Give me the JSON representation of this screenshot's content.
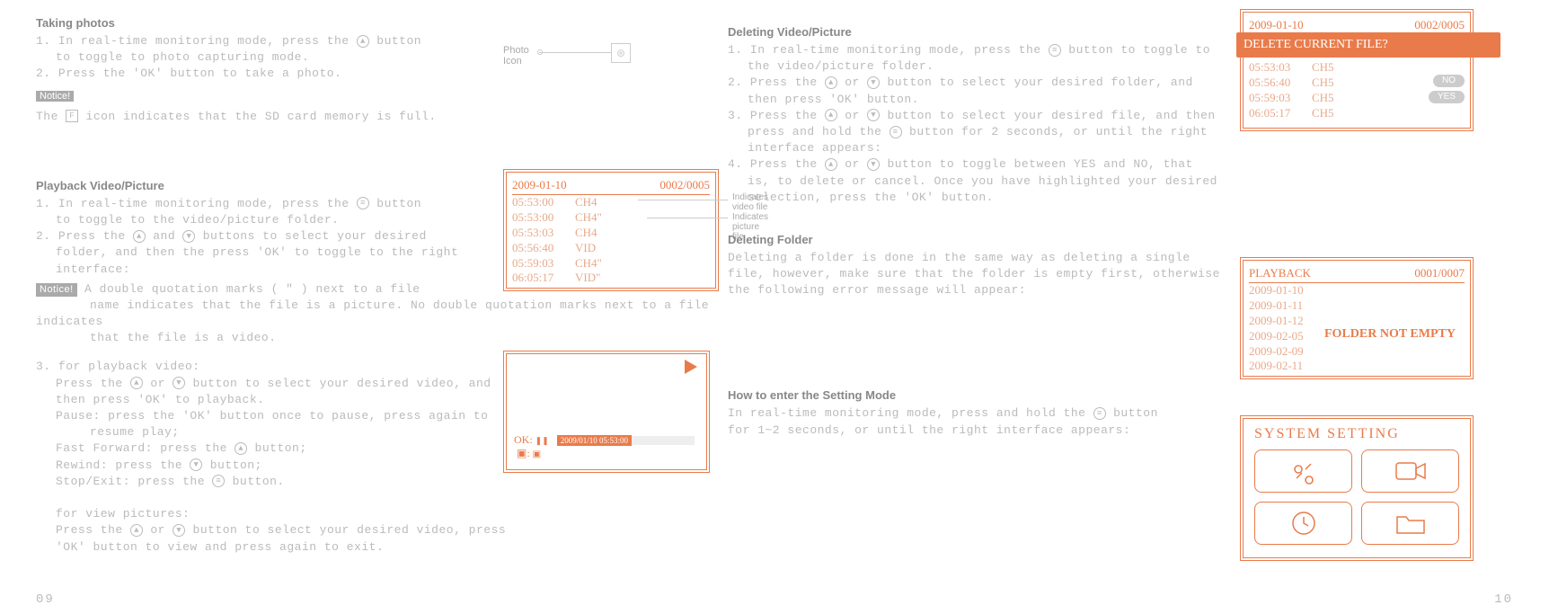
{
  "left": {
    "taking_photos": {
      "title": "Taking photos",
      "steps": [
        "1. In real-time monitoring mode, press the ▲ button to toggle to photo capturing mode.",
        "2. Press the 'OK' button to take a photo."
      ],
      "notice_label": "Notice!",
      "notice_text": "The",
      "notice_text2": "icon indicates that the SD card memory is full.",
      "f_icon": "F",
      "photo_icon_label": "Photo\nIcon",
      "camera_glyph": "⊛"
    },
    "playback": {
      "title": "Playback Video/Picture",
      "step1": "1. In real-time monitoring mode, press the ≡ button to toggle to the video/picture folder.",
      "step2": "2. Press the ▲ and ▼ buttons to select your desired folder, and then the press 'OK' to toggle to the right interface:",
      "notice_label": "Notice!",
      "notice_text": "A double quotation marks ( \" ) next to a file name indicates that the file is a picture. No double quotation marks next to a file indicates that the file is a video.",
      "step3_lead": "3. for playback video:",
      "step3_a": "Press the ▲ or ▼ button to select your desired video, and then press 'OK' to playback.",
      "step3_pause": "Pause: press the 'OK' button once to pause, press again to resume play;",
      "step3_ff": "Fast Forward: press the ▲ button;",
      "step3_rw": "Rewind: press the ▼ button;",
      "step3_stop": "Stop/Exit: press the ≡ button.",
      "step3_pics_lead": "for view pictures:",
      "step3_pics": "Press the ▲ or ▼ button to select your desired video, press 'OK' button to view and press again to exit."
    },
    "playback_screen": {
      "date": "2009-01-10",
      "counter": "0002/0005",
      "rows": [
        {
          "time": "05:53:00",
          "ch": "CH4"
        },
        {
          "time": "05:53:00",
          "ch": "CH4\""
        },
        {
          "time": "05:53:03",
          "ch": "CH4"
        },
        {
          "time": "05:56:40",
          "ch": "VID"
        },
        {
          "time": "05:59:03",
          "ch": "CH4\""
        },
        {
          "time": "06:05:17",
          "ch": "VID\""
        }
      ]
    },
    "callouts": {
      "video": "Indicates\nvideo file",
      "picture": "Indicates\npicture file"
    },
    "player": {
      "ok_label": "OK:",
      "pause_glyph": "❚❚",
      "timestamp": "2009/01/10   05:53:00",
      "exit_glyph": "▣:",
      "exit_icon": "▣"
    },
    "page_number": "09"
  },
  "right": {
    "deleting_file": {
      "title": "Deleting Video/Picture",
      "step1": "1. In real-time monitoring mode, press the ≡ button to toggle to the video/picture folder.",
      "step2": "2. Press the ▲ or ▼ button to select your desired folder, and then press 'OK' button.",
      "step3": "3. Press the ▲ or ▼ button to select your desired file, and then press and hold the ≡ button for 2 seconds, or until the right interface appears:",
      "step4": "4. Press the ▲ or ▼ button to toggle between YES and NO, that is, to delete or cancel. Once you have highlighted your desired selection, press the 'OK' button."
    },
    "deleting_folder": {
      "title": "Deleting Folder",
      "text": "Deleting a folder is done in the same way as deleting a single file, however, make sure that the folder is empty first, otherwise the following error message will appear:"
    },
    "setting_mode": {
      "title": "How to enter the Setting Mode",
      "text": "In real-time monitoring mode, press and hold the ≡ button for 1~2 seconds, or until the right interface appears:"
    },
    "page_number": "10"
  },
  "illus": {
    "delete_screen": {
      "date": "2009-01-10",
      "counter": "0002/0005",
      "banner": "DELETE CURRENT FILE?",
      "rows": [
        {
          "time": "05:53:03",
          "ch": "CH5"
        },
        {
          "time": "05:56:40",
          "ch": "CH5"
        },
        {
          "time": "05:59:03",
          "ch": "CH5"
        },
        {
          "time": "06:05:17",
          "ch": "CH5"
        }
      ],
      "no": "NO",
      "yes": "YES"
    },
    "folder_screen": {
      "header_left": "PLAYBACK",
      "header_right": "0001/0007",
      "folders": [
        "2009-01-10",
        "2009-01-11",
        "2009-01-12",
        "2009-02-05",
        "2009-02-09",
        "2009-02-11"
      ],
      "error": "FOLDER NOT EMPTY"
    },
    "system": {
      "title": "SYSTEM  SETTING"
    }
  }
}
